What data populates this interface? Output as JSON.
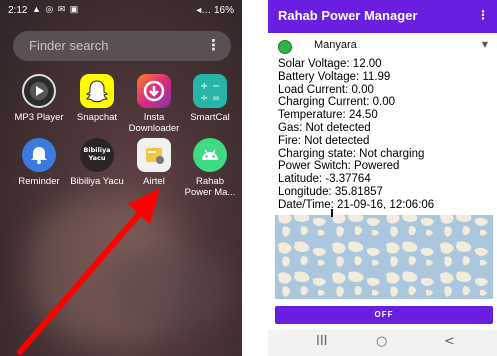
{
  "left_phone": {
    "status": {
      "time": "2:12",
      "icons": "▲ ◎ ✉ ▣",
      "battery": "◂… 16%"
    },
    "search": {
      "placeholder": "Finder search"
    },
    "apps_row1": [
      {
        "label": "MP3 Player",
        "icon": "play-icon",
        "color": "#2b2b2b"
      },
      {
        "label": "Snapchat",
        "icon": "ghost-icon",
        "color": "#fffc00"
      },
      {
        "label": "Insta\nDownloader",
        "icon": "download-icon",
        "color": "#d6249f"
      },
      {
        "label": "SmartCal",
        "icon": "calculator-icon",
        "color": "#26b5a6"
      }
    ],
    "apps_row2": [
      {
        "label": "Reminder",
        "icon": "bell-icon",
        "color": "#3b7be0"
      },
      {
        "label": "Bibiliya Yacu",
        "icon": "bible-icon",
        "color": "#2a2424",
        "icon_text": "Bibiliya\nYacu"
      },
      {
        "label": "Airtel",
        "icon": "airtel-icon",
        "color": "#f1f1f1"
      },
      {
        "label": "Rahab\nPower Ma...",
        "icon": "android-icon",
        "color": "#3ddc84"
      }
    ]
  },
  "right_phone": {
    "app_title": "Rahab Power Manager",
    "menu_glyph": "⋮",
    "spinner": {
      "value": "Manyara",
      "status_color": "#2fb344"
    },
    "details": [
      "Solar Voltage: 12.00",
      "Battery Voltage: 11.99",
      "Load Current: 0.00",
      "Charging Current: 0.00",
      "Temperature: 24.50",
      "Gas: Not detected",
      "Fire: Not detected",
      "Charging state: Not charging",
      "Power Switch: Powered",
      "Latitude: -3.37764",
      "Longitude: 35.81857",
      "Date/Time: 21-09-16, 12:06:06"
    ],
    "off_button": "OFF",
    "nav": {
      "recent": "III",
      "home": "○",
      "back": "<"
    }
  },
  "colors": {
    "accent": "#6a1fe0",
    "arrow": "#ff0000"
  }
}
